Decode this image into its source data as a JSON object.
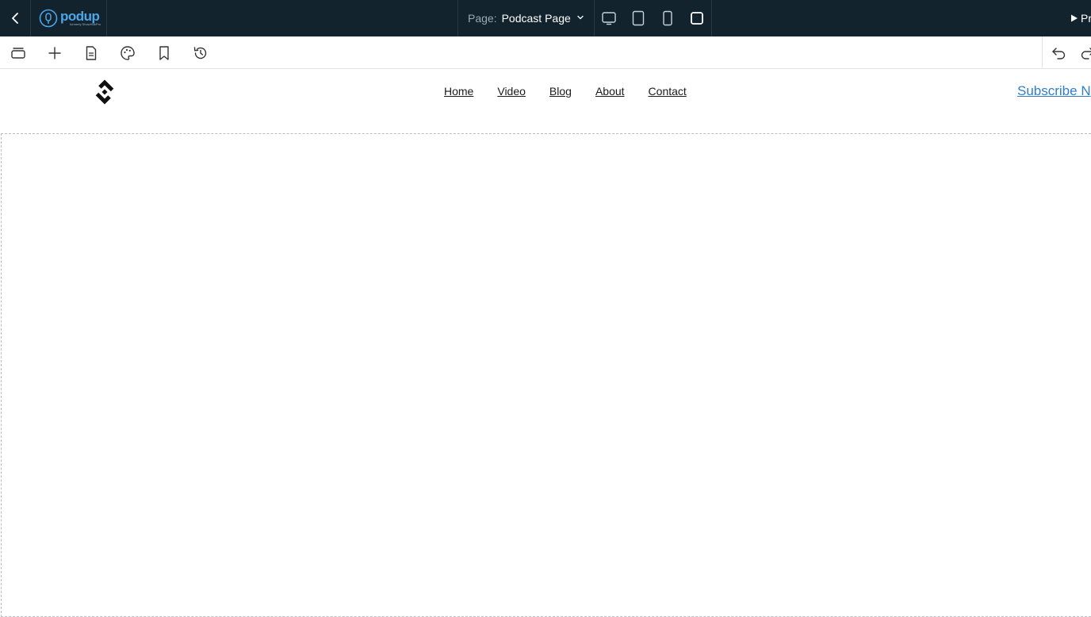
{
  "topbar": {
    "brand": {
      "name": "podup",
      "subtitle": "formerly ShowHubPro"
    },
    "page_prefix": "Page:",
    "page_name": "Podcast Page",
    "preview_label": "Pr",
    "devices": [
      {
        "icon": "desktop-icon"
      },
      {
        "icon": "tablet-icon"
      },
      {
        "icon": "mobile-icon"
      },
      {
        "icon": "fullscreen-icon"
      }
    ]
  },
  "toolbar": {
    "tools": [
      "layers-icon",
      "add-icon",
      "page-icon",
      "palette-icon",
      "bookmark-icon",
      "history-icon"
    ],
    "history": [
      "undo-icon",
      "redo-icon"
    ]
  },
  "site": {
    "nav": [
      "Home",
      "Video",
      "Blog",
      "About",
      "Contact"
    ],
    "subscribe_label": "Subscribe N"
  },
  "colors": {
    "topbar_bg": "#12232e",
    "brand_accent": "#4aa6e8",
    "link_blue": "#2f7fc8"
  }
}
